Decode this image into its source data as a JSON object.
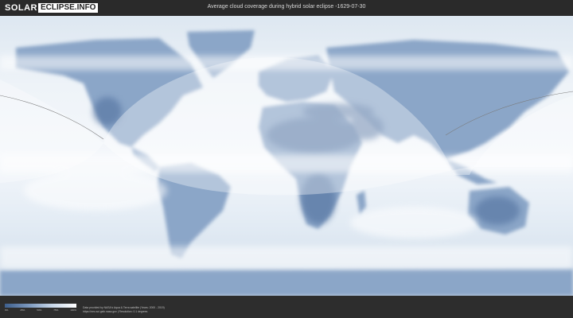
{
  "header": {
    "brand_word": "SOLAR",
    "brand_domain": "ECLIPSE.INFO",
    "title": "Average cloud coverage during hybrid solar eclipse -1629-07-30"
  },
  "legend": {
    "ticks": [
      "0%",
      "25%",
      "50%",
      "75%",
      "100%"
    ],
    "colors": [
      "#3e5f8d",
      "#7b98bf",
      "#c9d8ea",
      "#ffffff"
    ]
  },
  "footer": {
    "credit_line1": "Data provided by NASA's Aqua & Terra satellite (Years: 2000 - 2019)",
    "credit_line2": "https://neo.sci.gsfc.nasa.gov | Resolution: 0.1 degrees"
  },
  "map": {
    "ocean_color": "#eef3f8",
    "land_color": "#7f9cc2",
    "cloud_color": "#ffffff",
    "overlay_color": "#ffffff"
  }
}
